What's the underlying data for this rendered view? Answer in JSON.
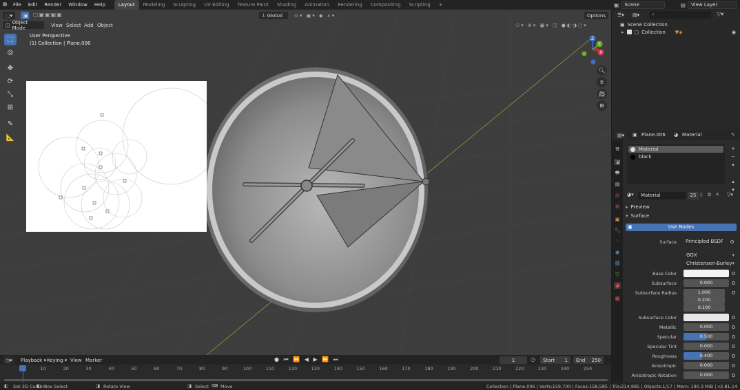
{
  "topbar": {
    "menus": [
      "File",
      "Edit",
      "Render",
      "Window",
      "Help"
    ],
    "workspaces": [
      "Layout",
      "Modeling",
      "Sculpting",
      "UV Editing",
      "Texture Paint",
      "Shading",
      "Animation",
      "Rendering",
      "Compositing",
      "Scripting"
    ],
    "active_workspace": "Layout",
    "add_tab": "+",
    "scene": "Scene",
    "view_layer": "View Layer"
  },
  "viewport": {
    "mode": "Object Mode",
    "menus": [
      "View",
      "Select",
      "Add",
      "Object"
    ],
    "orientation": "Global",
    "options": "Options",
    "info_line1": "User Perspective",
    "info_line2": "(1) Collection | Plane.006",
    "gizmo": {
      "z": "Z",
      "y": "Y",
      "x": "X"
    }
  },
  "timeline": {
    "menus": [
      "Playback",
      "Keying",
      "View",
      "Marker"
    ],
    "current_frame": "1",
    "start_label": "Start",
    "start": "1",
    "end_label": "End",
    "end": "250",
    "ticks": [
      "1",
      "10",
      "20",
      "30",
      "40",
      "50",
      "60",
      "70",
      "80",
      "90",
      "100",
      "110",
      "120",
      "130",
      "140",
      "150",
      "160",
      "170",
      "180",
      "190",
      "200",
      "210",
      "220",
      "230",
      "240",
      "250"
    ]
  },
  "statusbar": {
    "items": [
      "Set 3D Cursor",
      "Box Select",
      "Rotate View",
      "Select",
      "Move"
    ],
    "stats": "Collection | Plane.006 | Verts:159,700 | Faces:158,585 | Tris:214,985 | Objects:1/17 | Mem: 190.3 MiB | v2.81.14"
  },
  "outliner": {
    "search_placeholder": "",
    "scene_collection": "Scene Collection",
    "collection": "Collection"
  },
  "properties": {
    "object": "Plane.006",
    "material_tab": "Material",
    "slots": [
      "Material",
      "black"
    ],
    "material_name": "Material",
    "users": "25",
    "preview": "Preview",
    "surface_section": "Surface",
    "use_nodes": "Use Nodes",
    "surface_label": "Surface",
    "surface_value": "Principled BSDF",
    "distribution": "GGX",
    "subsurface_method": "Christensen-Burley",
    "base_color_label": "Base Color",
    "base_color": "#f2f2f2",
    "rows": [
      {
        "label": "Subsurface",
        "value": "0.000"
      },
      {
        "label": "Subsurface Radius",
        "value": "1.000"
      },
      {
        "label": "",
        "value": "0.200"
      },
      {
        "label": "",
        "value": "0.100"
      },
      {
        "label": "Subsurface Color",
        "value": ""
      },
      {
        "label": "Metallic",
        "value": "0.000"
      },
      {
        "label": "Specular",
        "value": "0.500"
      },
      {
        "label": "Specular Tint",
        "value": "0.000"
      },
      {
        "label": "Roughness",
        "value": "0.400"
      },
      {
        "label": "Anisotropic",
        "value": "0.000"
      },
      {
        "label": "Anisotropic Rotation",
        "value": "0.000"
      }
    ],
    "specular_fill": 0.5,
    "roughness_fill": 0.4,
    "accent": "#4772b3"
  }
}
